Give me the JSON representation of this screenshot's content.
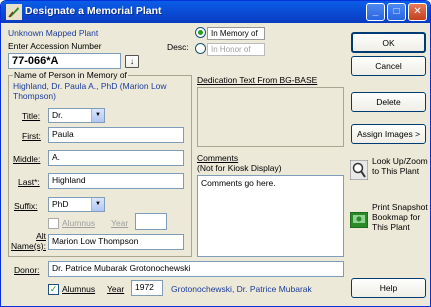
{
  "window": {
    "title": "Designate a Memorial Plant"
  },
  "plant": {
    "status": "Unknown Mapped Plant",
    "accession_label": "Enter Accession Number",
    "accession_value": "77-066*A"
  },
  "desc": {
    "label": "Desc:",
    "option_in_memory": "In Memory of",
    "option_in_honor": "In Honor of",
    "selected": "In Memory of"
  },
  "person": {
    "group_label": "Name of Person in Memory of",
    "name_line": "Highland, Dr. Paula A., PhD (Marion Low Thompson)",
    "title_label": "Title:",
    "title_value": "Dr.",
    "first_label": "First:",
    "first_value": "Paula",
    "middle_label": "Middle:",
    "middle_value": "A.",
    "last_label": "Last*:",
    "last_value": "Highland",
    "suffix_label": "Suffix:",
    "suffix_value": "PhD",
    "alumnus_label": "Alumnus",
    "alumnus_checked": false,
    "year_label": "Year",
    "year_value": "",
    "alt_names_label": "Alt Name(s):",
    "alt_names_value": "Marion Low Thompson"
  },
  "dedication": {
    "label": "Dedication Text From BG-BASE",
    "value": ""
  },
  "comments": {
    "label": "Comments",
    "sublabel": "(Not for Kiosk Display)",
    "value": "Comments go here."
  },
  "donor": {
    "label": "Donor:",
    "value": "Dr. Patrice Mubarak Grotonochewski",
    "alumnus_label": "Alumnus",
    "alumnus_checked": true,
    "year_label": "Year",
    "year_value": "1972",
    "sort_name": "Grotonochewski, Dr. Patrice Mubarak"
  },
  "buttons": {
    "ok": "OK",
    "cancel": "Cancel",
    "delete": "Delete",
    "assign_images": "Assign Images >",
    "help": "Help"
  },
  "side_actions": {
    "lookup": "Look Up/Zoom to This Plant",
    "print": "Print Snapshot Bookmap for This Plant"
  },
  "colors": {
    "title_bar": "#0a48d0",
    "accent_text": "#1c3c9c",
    "dialog_bg": "#ece9d8"
  }
}
